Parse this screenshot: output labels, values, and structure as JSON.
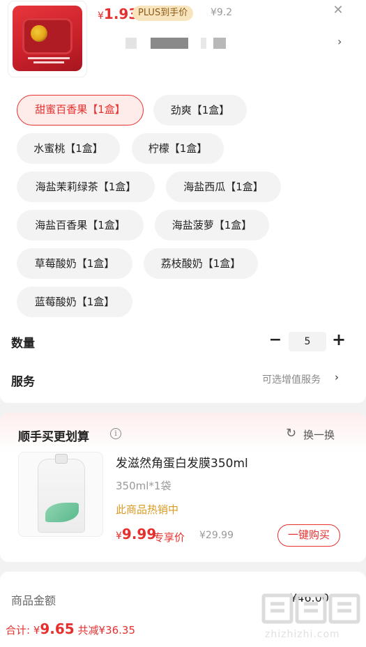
{
  "header": {
    "price_symbol": "¥",
    "price_value": "1.93",
    "plus_badge": "PLUS到手价",
    "original_price": "¥9.2",
    "close_icon": "close-icon",
    "chevron_icon": "chevron-right-icon"
  },
  "options": [
    {
      "label": "甜蜜百香果【1盒】",
      "selected": true
    },
    {
      "label": "劲爽【1盒】",
      "selected": false
    },
    {
      "label": "水蜜桃【1盒】",
      "selected": false
    },
    {
      "label": "柠檬【1盒】",
      "selected": false
    },
    {
      "label": "海盐茉莉绿茶【1盒】",
      "selected": false
    },
    {
      "label": "海盐西瓜【1盒】",
      "selected": false
    },
    {
      "label": "海盐百香果【1盒】",
      "selected": false
    },
    {
      "label": "海盐菠萝【1盒】",
      "selected": false
    },
    {
      "label": "草莓酸奶【1盒】",
      "selected": false
    },
    {
      "label": "荔枝酸奶【1盒】",
      "selected": false
    },
    {
      "label": "蓝莓酸奶【1盒】",
      "selected": false
    }
  ],
  "quantity": {
    "label": "数量",
    "minus": "−",
    "value": "5",
    "plus": "+"
  },
  "service": {
    "label": "服务",
    "hint": "可选增值服务",
    "chevron": "›"
  },
  "addon": {
    "title": "顺手买更划算",
    "info_icon": "i",
    "refresh_icon": "↻",
    "refresh_label": "换一换",
    "product_name": "发滋然角蛋白发膜350ml",
    "spec": "350ml*1袋",
    "hot_label": "此商品热销中",
    "price_symbol": "¥",
    "price_value": "9.99",
    "exclusive_label": "专享价",
    "original_price": "¥29.99",
    "buy_button": "一键购买"
  },
  "summary": {
    "amount_label": "商品金额",
    "amount_value": "¥46.00"
  },
  "total": {
    "prefix": "合计: ",
    "symbol": "¥",
    "value": "9.65",
    "discount": " 共减¥36.35"
  },
  "watermark": {
    "logo_text": "值值值",
    "url": "zhizhizhi.com"
  },
  "colors": {
    "accent": "#e5302e",
    "plus_badge_bg": "#f8e5bd",
    "hot_text": "#d99a22"
  }
}
